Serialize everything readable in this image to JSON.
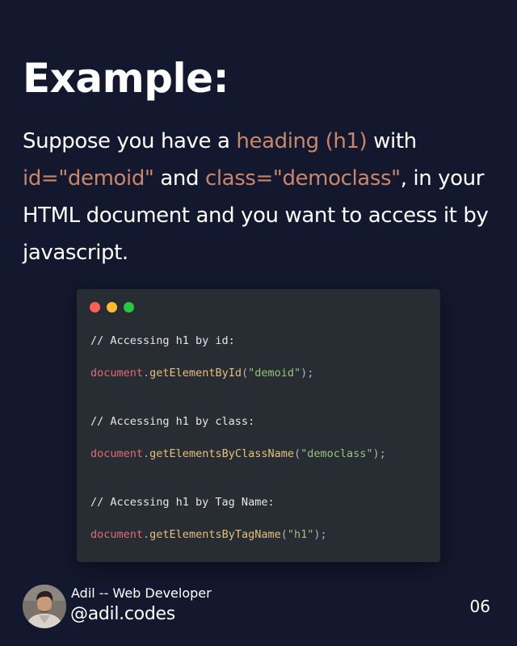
{
  "heading": "Example:",
  "intro": {
    "p1": "Suppose you have a ",
    "h1": "heading (h1)",
    "p2": " with ",
    "h2": "id=\"demoid\"",
    "p3": " and ",
    "h3": "class=\"democlass\"",
    "p4": ", in your HTML document and you want to access it by javascript."
  },
  "code": {
    "comment_id": "// Accessing h1 by id:",
    "comment_class": "// Accessing h1 by class:",
    "comment_tag": "// Accessing h1 by Tag Name:",
    "obj": "document",
    "dot": ".",
    "open": "(",
    "close": ");",
    "fn_id": "getElementById",
    "arg_id": "\"demoid\"",
    "fn_class": "getElementsByClassName",
    "arg_class": "\"democlass\"",
    "fn_tag": "getElementsByTagName",
    "arg_tag": "\"h1\""
  },
  "window_dots": [
    "#ff5f57",
    "#febc2e",
    "#28c840"
  ],
  "footer": {
    "name": "Adil -- Web Developer",
    "handle": "@adil.codes",
    "page": "06"
  },
  "colors": {
    "background": "#13182e",
    "highlight": "#c9876a",
    "code_bg": "#282c33"
  }
}
